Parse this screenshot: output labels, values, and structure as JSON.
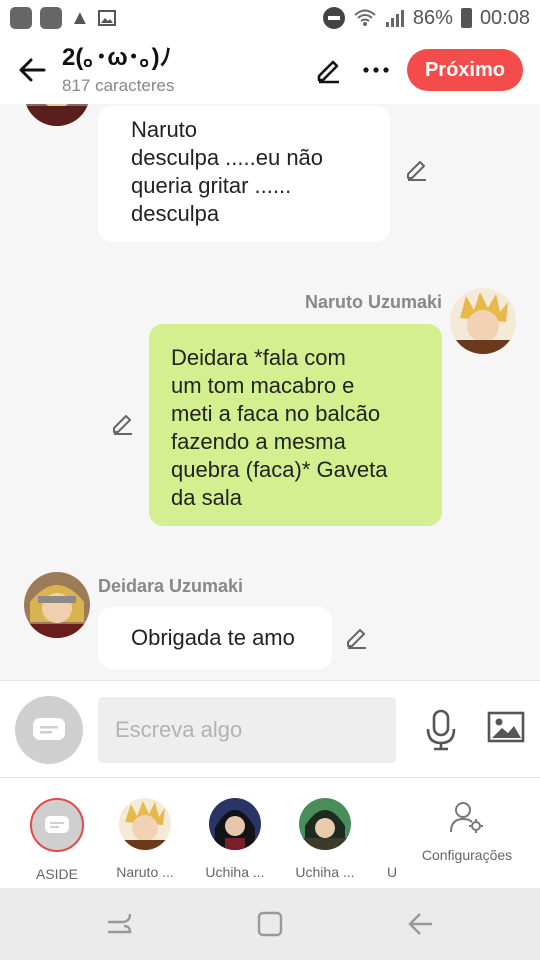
{
  "status_bar": {
    "battery": "86%",
    "time": "00:08"
  },
  "header": {
    "title": "2(｡･ω･｡)ﾉ",
    "char_count": "817 caracteres",
    "next_label": "Próximo"
  },
  "messages": [
    {
      "side": "left",
      "sender": "",
      "text": "Naruto\ndesculpa .....eu não\nqueria gritar ......\ndesculpa"
    },
    {
      "side": "right",
      "sender": "Naruto Uzumaki",
      "text": "Deidara *fala com\num tom macabro e\nmeti a faca no balcão\nfazendo a mesma\nquebra (faca)* Gaveta\nda sala"
    },
    {
      "side": "left",
      "sender": "Deidara Uzumaki",
      "text": "Obrigada te amo"
    }
  ],
  "input": {
    "placeholder": "Escreva algo"
  },
  "characters": [
    {
      "label": "ASIDE"
    },
    {
      "label": "Naruto ..."
    },
    {
      "label": "Uchiha ..."
    },
    {
      "label": "Uchiha ..."
    },
    {
      "label": "U"
    }
  ],
  "settings_label": "Configurações",
  "colors": {
    "accent": "#f44b4b",
    "bubble_mine": "#d4ef8f",
    "bubble_other": "#ffffff"
  }
}
